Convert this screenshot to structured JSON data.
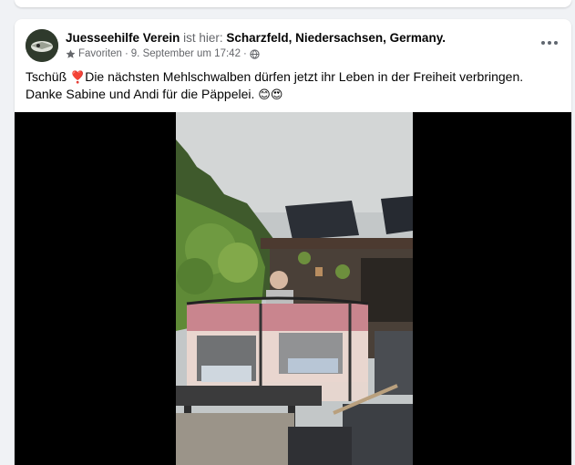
{
  "post": {
    "author": "Juesseehilfe Verein",
    "is_here": " ist hier: ",
    "place": "Scharzfeld, Niedersachsen, Germany.",
    "audience": "Favoriten",
    "separator": "·",
    "date": "9. September um 17:42",
    "text_start": "Tschüß ",
    "heart_emoji": "❣️",
    "text_main": "Die nächsten Mehlschwalben dürfen jetzt ihr Leben in der Freiheit verbringen. Danke Sabine und Andi für die Päppelei. ",
    "emojis": "😊😍"
  },
  "icons": {
    "more": "more-options-icon",
    "audience": "star-icon",
    "privacy": "globe-icon"
  },
  "colors": {
    "primary_text": "#050505",
    "secondary_text": "#65676b",
    "page_bg": "#f0f2f5"
  }
}
